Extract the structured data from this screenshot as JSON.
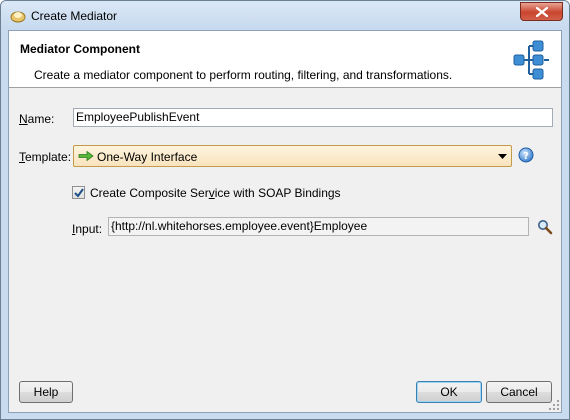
{
  "window": {
    "title": "Create Mediator"
  },
  "header": {
    "title": "Mediator Component",
    "description": "Create a mediator component to perform routing, filtering, and transformations."
  },
  "form": {
    "name_label_mnemonic": "N",
    "name_label_rest": "ame:",
    "name_value": "EmployeePublishEvent",
    "template_label_mnemonic": "T",
    "template_label_rest": "emplate:",
    "template_value": "One-Way Interface",
    "checkbox_checked": true,
    "checkbox_label_before": "Create Composite Ser",
    "checkbox_label_mnemonic": "v",
    "checkbox_label_after": "ice with SOAP Bindings",
    "input_label_mnemonic": "I",
    "input_label_rest": "nput:",
    "input_value": "{http://nl.whitehorses.employee.event}Employee"
  },
  "buttons": {
    "help": "Help",
    "ok": "OK",
    "cancel": "Cancel"
  },
  "icons": {
    "app": "mediator-app-icon",
    "close": "close-icon",
    "header": "mediator-component-icon",
    "template": "green-arrow-icon",
    "dropdown": "chevron-down-icon",
    "help": "help-icon",
    "search": "search-icon",
    "resize": "resize-grip-icon"
  },
  "colors": {
    "title_bar": "#c6d9ee",
    "close_button": "#c9452f",
    "combo_focus_border": "#c49b4b",
    "default_button_border": "#3c7fb1"
  }
}
